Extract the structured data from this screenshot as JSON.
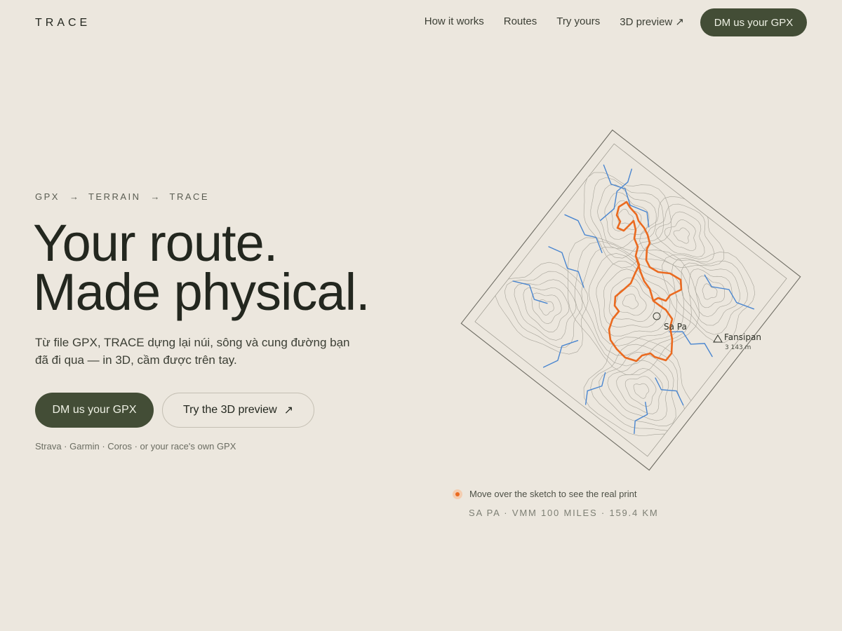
{
  "nav": {
    "logo": "TRACE",
    "links": [
      "How it works",
      "Routes",
      "Try yours",
      "3D preview ↗"
    ],
    "cta": "DM us your GPX"
  },
  "hero": {
    "eyebrow": [
      "GPX",
      "TERRAIN",
      "TRACE"
    ],
    "eyebrow_arrow": "→",
    "headline": [
      "Your route.",
      "Made physical."
    ],
    "lede": "Từ file GPX, TRACE dựng lại núi, sông và cung đường bạn đã đi qua — in 3D, cầm được trên tay.",
    "primary_cta": "DM us your GPX",
    "secondary_cta": "Try the 3D preview",
    "secondary_cta_icon": "↗",
    "sources": "Strava · Garmin · Coros · or your race's own GPX"
  },
  "map": {
    "town_label": "Sa Pa",
    "peak_label": "Fansipan",
    "peak_elevation": "3 143 m",
    "hint": "Move over the sketch to see the real print",
    "route_meta": "SA PA · VMM 100 MILES · 159.4 KM",
    "colors": {
      "route": "#ea6a20",
      "rivers": "#4a86d0",
      "contours": "#9b988e",
      "border": "#6e6c63"
    }
  },
  "colors": {
    "background": "#ece7de",
    "accent": "#434d36",
    "text": "#23271f"
  }
}
